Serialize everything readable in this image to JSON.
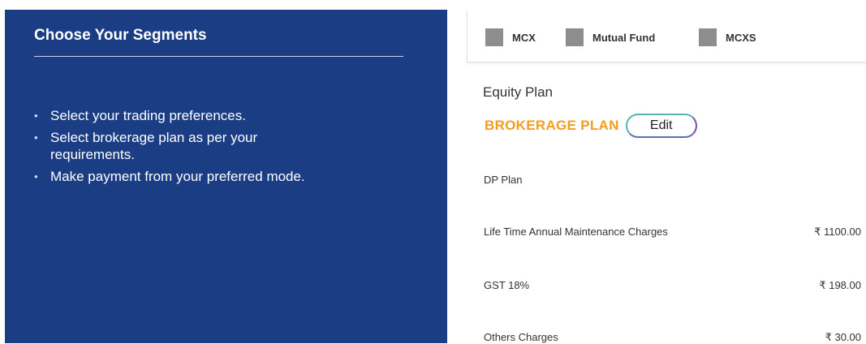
{
  "left": {
    "title": "Choose Your Segments",
    "bullets": [
      "Select your trading preferences.",
      "Select brokerage plan as per your requirements.",
      "Make payment from your preferred mode."
    ],
    "bullet_glyph": "•"
  },
  "segments": [
    {
      "label": "MCX",
      "checkbox_color": "#8d8d8d"
    },
    {
      "label": "Mutual Fund",
      "checkbox_color": "#8d8d8d"
    },
    {
      "label": "MCXS",
      "checkbox_color": "#8d8d8d"
    }
  ],
  "equity": {
    "title": "Equity Plan",
    "plan_label": "BROKERAGE PLAN",
    "edit_label": "Edit"
  },
  "dp": {
    "title": "DP Plan",
    "rows": [
      {
        "label": "Life Time Annual Maintenance Charges",
        "value": "₹ 1100.00"
      },
      {
        "label": "GST 18%",
        "value": "₹ 198.00"
      },
      {
        "label": "Others Charges",
        "value": "₹ 30.00"
      }
    ]
  },
  "colors": {
    "panel_bg": "#1a3d84",
    "accent_orange": "#f59d1c",
    "checkbox_gray": "#8d8d8d"
  }
}
